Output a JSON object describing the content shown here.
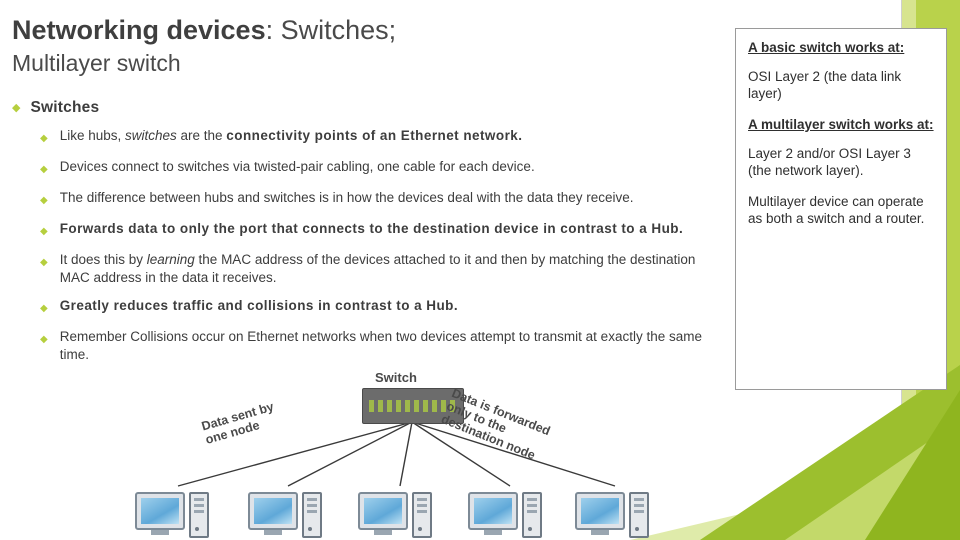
{
  "slide": {
    "title": {
      "strong": "Networking devices",
      "rest": ": Switches;",
      "line2": "Multilayer switch"
    },
    "bullets": [
      {
        "level": 1,
        "marker": "◆",
        "segments": [
          {
            "text": "Switches",
            "style": "bold"
          }
        ]
      },
      {
        "level": 2,
        "marker": "◆",
        "segments": [
          {
            "text": "Like hubs, ",
            "style": "normal"
          },
          {
            "text": "switches",
            "style": "italic"
          },
          {
            "text": " are the ",
            "style": "normal"
          },
          {
            "text": "connectivity points of an Ethernet network.",
            "style": "bold"
          }
        ]
      },
      {
        "level": 2,
        "marker": "◆",
        "segments": [
          {
            "text": "Devices connect to switches via twisted-pair cabling, one cable for each device.",
            "style": "normal"
          }
        ]
      },
      {
        "level": 2,
        "marker": "◆",
        "segments": [
          {
            "text": "The difference between hubs and switches is in how the devices deal with the data they receive.",
            "style": "normal"
          }
        ]
      },
      {
        "level": 2,
        "marker": "◆",
        "segments": [
          {
            "text": "Forwards data to only the port that connects to the destination device in contrast to a Hub.",
            "style": "bold"
          }
        ]
      },
      {
        "level": 2,
        "marker": "◆",
        "segments": [
          {
            "text": "It does this by ",
            "style": "normal"
          },
          {
            "text": "learning",
            "style": "italic"
          },
          {
            "text": " the MAC address of the devices attached to it and then by matching the destination MAC address in the data it receives.",
            "style": "normal"
          }
        ]
      },
      {
        "level": 2,
        "marker": "◆",
        "segments": [
          {
            "text": "Greatly reduces traffic and collisions in contrast to a Hub.",
            "style": "bold"
          }
        ]
      },
      {
        "level": 2,
        "marker": "◆",
        "segments": [
          {
            "text": "Remember Collisions occur on Ethernet networks when two devices attempt to transmit at exactly the same time.",
            "style": "normal"
          }
        ]
      }
    ],
    "sidebar": {
      "paragraphs": [
        {
          "text": "A basic switch works at:",
          "style": "bold-underline"
        },
        {
          "text": "OSI Layer 2 (the data link layer)",
          "style": "normal"
        },
        {
          "text": "A multilayer switch works at:",
          "style": "bold-underline"
        },
        {
          "text": "Layer 2 and/or OSI Layer 3 (the network layer).",
          "style": "normal"
        },
        {
          "text": "Multilayer device can operate as both a switch and a router.",
          "style": "normal"
        }
      ]
    },
    "diagram": {
      "switch_label": "Switch",
      "annotation_left": "Data sent by\none node",
      "annotation_right": "Data is forwarded\nonly to the\ndestination node",
      "node_count": 5
    },
    "colors": {
      "accent_green": "#b9d24b",
      "accent_green_dark": "#9cbf2e",
      "bullet_green": "#b6cf3e",
      "text": "#3d3d3d",
      "title": "#4a4a4a"
    }
  }
}
